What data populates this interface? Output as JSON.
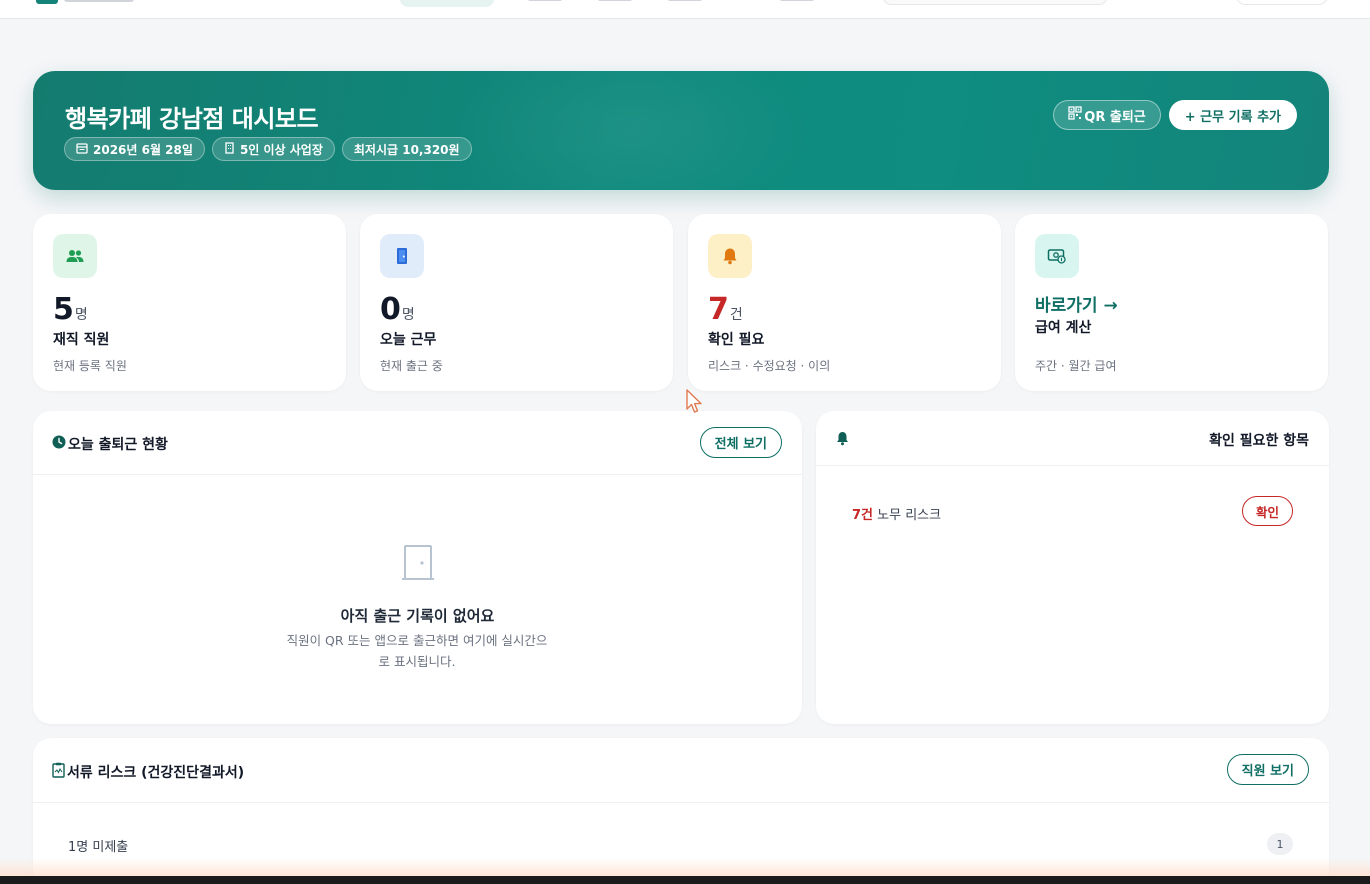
{
  "hero": {
    "title": "행복카페 강남점 대시보드",
    "chips": [
      {
        "icon": "calendar-icon",
        "label": "2026년 6월 28일"
      },
      {
        "icon": "building-icon",
        "label": "5인 이상 사업장"
      },
      {
        "icon": "",
        "label": "최저시급 10,320원"
      }
    ],
    "qr_button": "QR 출퇴근",
    "add_button": "+ 근무 기록 추가"
  },
  "stats": [
    {
      "icon": "people-icon",
      "value": "5",
      "unit": "명",
      "label": "재직 직원",
      "sub": "현재 등록 직원",
      "icon_bg": "#dff5e7",
      "icon_color": "#1f9d55"
    },
    {
      "icon": "door-icon",
      "value": "0",
      "unit": "명",
      "label": "오늘 근무",
      "sub": "현재 출근 중",
      "icon_bg": "#e1ecfb",
      "icon_color": "#2b6cd6"
    },
    {
      "icon": "bell-icon",
      "value": "7",
      "unit": "건",
      "label": "확인 필요",
      "sub": "리스크 · 수정요청 · 이의",
      "icon_bg": "#fdf0c7",
      "icon_color": "#d97706",
      "value_color": "#c62828"
    },
    {
      "icon": "money-icon",
      "link": "바로가기 →",
      "label": "급여 계산",
      "sub": "주간 · 월간 급여",
      "icon_bg": "#d8f6ef",
      "icon_color": "#0f6f64"
    }
  ],
  "attendance": {
    "title": "오늘 출퇴근 현황",
    "view_all": "전체 보기",
    "empty_title": "아직 출근 기록이 없어요",
    "empty_desc": "직원이 QR 또는 앱으로 출근하면 여기에 실시간으로 표시됩니다."
  },
  "checks": {
    "title": "확인 필요한 항목",
    "item_count": "7건",
    "item_label": "노무 리스크",
    "item_button": "확인"
  },
  "documents": {
    "title": "서류 리스크 (건강진단결과서)",
    "button": "직원 보기",
    "row_label": "1명 미제출",
    "row_badge": "1"
  },
  "colors": {
    "brand": "#0f8a7d",
    "danger": "#c62828"
  }
}
